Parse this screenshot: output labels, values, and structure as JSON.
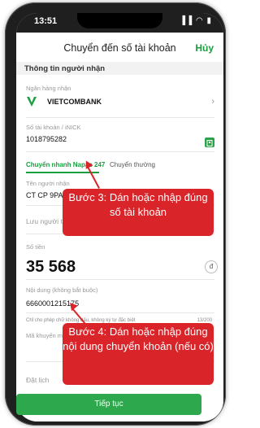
{
  "status": {
    "time": "13:51",
    "sys_icons": "▐▐ ◠ ▮"
  },
  "nav": {
    "title": "Chuyển đến số tài khoản",
    "cancel": "Hủy"
  },
  "section_title": "Thông tin người nhận",
  "bank": {
    "label": "Ngân hàng nhận",
    "name": "VIETCOMBANK",
    "logo_color": "#1a9e3f"
  },
  "account": {
    "label": "Số tài khoản / iNICK",
    "value": "1018795282"
  },
  "tabs": {
    "active": "Chuyển nhanh Napas 247",
    "inactive": "Chuyển thường"
  },
  "recipient": {
    "label": "Tên người nhận",
    "value": "CT CP 9PAY"
  },
  "save_recipient": {
    "label": "Lưu người t"
  },
  "amount": {
    "label": "Số tiền",
    "value": "35 568",
    "currency": "đ"
  },
  "content": {
    "label": "Nội dung (không bắt buộc)",
    "value": "6660001215175",
    "hint": "Chỉ cho phép chữ không dấu, không ký tự đặc biệt",
    "counter": "13/200"
  },
  "promo": {
    "label": "Mã khuyến m"
  },
  "schedule": {
    "label": "Đặt lịch"
  },
  "submit": {
    "label": "Tiếp tục"
  },
  "callouts": {
    "step3": "Bước 3: Dán hoặc nhập đúng số tài khoản",
    "step4": "Bước 4: Dán hoặc nhập đúng nội dung chuyển khoản (nếu có)"
  },
  "colors": {
    "accent": "#1a9e3f",
    "button": "#2ea84c",
    "callout": "#d9242a"
  }
}
